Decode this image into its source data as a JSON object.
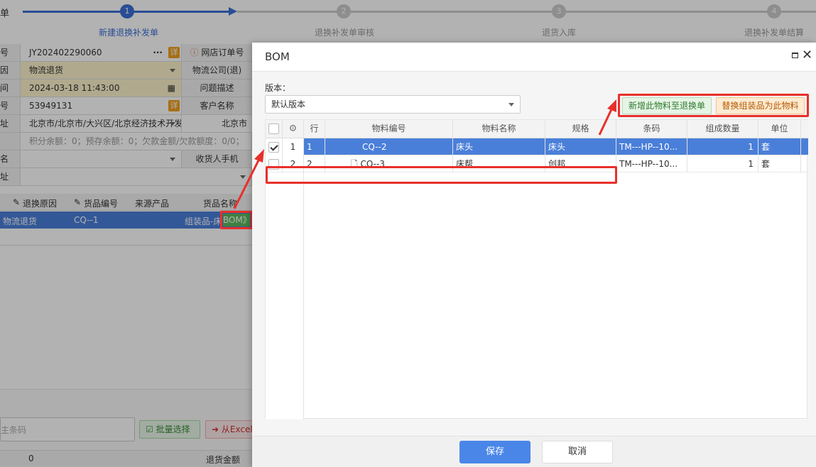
{
  "steps": [
    {
      "num": "1",
      "label": "新建退换补发单"
    },
    {
      "num": "2",
      "label": "退换补发单审核"
    },
    {
      "num": "3",
      "label": "退货入库"
    },
    {
      "num": "4",
      "label": "退换补发单结算"
    }
  ],
  "bg_page": {
    "title_fragment": "单",
    "rows": [
      {
        "label": "号",
        "value": "JY202402290060",
        "right_label": "网店订单号"
      },
      {
        "label": "因",
        "value": "物流退货",
        "right_label": "物流公司(退)"
      },
      {
        "label": "间",
        "value": "2024-03-18 11:43:00",
        "right_label": "问题描述"
      },
      {
        "label": "号",
        "value": "53949131",
        "right_label": "客户名称"
      },
      {
        "label": "址",
        "value": "北京市/北京市/大兴区/北京经济技术开发区",
        "right_label": "北京市"
      },
      {
        "label": "",
        "value": "积分余额：0；预存余额：0；欠款金额/欠款额度：0/0；",
        "right_label": ""
      },
      {
        "label": "名",
        "value": "",
        "right_label": "收货人手机"
      },
      {
        "label": "址",
        "value": "",
        "right_label": ""
      }
    ],
    "xiang_tag": "详",
    "grid_headers": [
      "退换原因",
      "货品编号",
      "来源产品",
      "货品名称"
    ],
    "grid_row": {
      "reason": "物流退货",
      "code": "CQ--1",
      "source": "",
      "name": "组装品-床"
    },
    "bom_tag": "BOM》",
    "barcode_placeholder": "主条码",
    "batch_select_label": "批量选择",
    "excel_label": "从Excel",
    "footer_value": "0",
    "footer_label": "退货金额"
  },
  "modal": {
    "title": "BOM",
    "version_label": "版本：",
    "version_value": "默认版本",
    "add_button": "新增此物料至退换单",
    "replace_button": "替换组装品为此物料",
    "columns": [
      "行",
      "物料编号",
      "物料名称",
      "规格",
      "条码",
      "组成数量",
      "单位"
    ],
    "rows": [
      {
        "index": "1",
        "line": "1",
        "code": "CQ--2",
        "name": "床头",
        "spec": "床头",
        "barcode": "TM---HP--10...",
        "qty": "1",
        "unit": "套",
        "checked": true,
        "selected": true
      },
      {
        "index": "2",
        "line": "2",
        "code": "CQ--3",
        "name": "床帮",
        "spec": "创邦",
        "barcode": "TM---HP--10...",
        "qty": "1",
        "unit": "套",
        "checked": false,
        "selected": false
      }
    ],
    "save_button": "保存",
    "cancel_button": "取消"
  },
  "colors": {
    "accent": "#4a86e8",
    "selected_row": "#4a7fd9",
    "highlight": "#e8302b"
  }
}
